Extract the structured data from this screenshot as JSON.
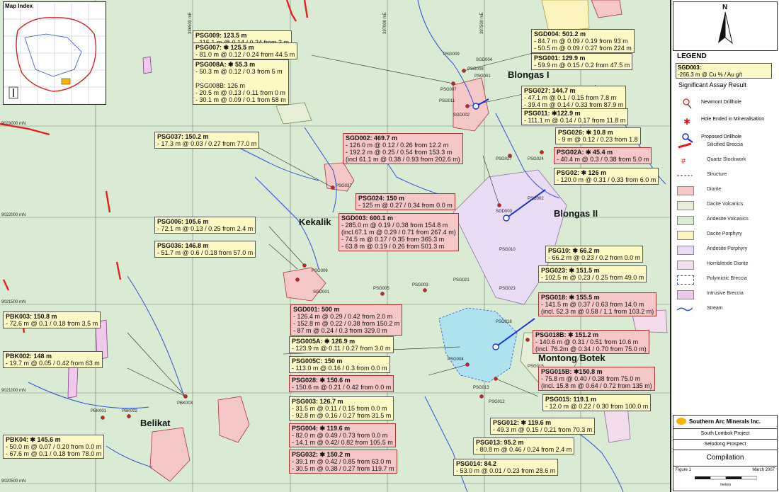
{
  "inset": {
    "title": "Map Index"
  },
  "places": [
    {
      "id": "blongas-1",
      "text": "Blongas I"
    },
    {
      "id": "blongas-2",
      "text": "Blongas II"
    },
    {
      "id": "kekalik",
      "text": "Kekalik"
    },
    {
      "id": "montong-botek",
      "text": "Montong Botek"
    },
    {
      "id": "belikat",
      "text": "Belikat"
    }
  ],
  "coords": {
    "north": [
      "9023000 mN",
      "9022000 mN",
      "9021500 mN",
      "9021000 mN",
      "9020500 mN"
    ],
    "east": [
      "396500 mE",
      "397000 mE",
      "397500 mE"
    ]
  },
  "hole_labels": [
    "PSG009",
    "PSG008",
    "PSG007",
    "PSG006",
    "PSG001",
    "PSG002",
    "PSG037",
    "PSG027",
    "PSG024",
    "PSG010",
    "PSG023",
    "PSG005",
    "PSG003",
    "PSG021",
    "PSG018",
    "PSG011",
    "PSG015",
    "PSG013",
    "PSG004",
    "PSG012",
    "PBK003",
    "PBK001",
    "PBK002",
    "SGD001",
    "SGD002",
    "SGD003",
    "SGD004"
  ],
  "labels": [
    {
      "id": "psg009",
      "style": "yel",
      "lines": [
        "PSG009: 123.5 m",
        "- 115.1 m @ 0.14 / 0.24 from 3 m"
      ]
    },
    {
      "id": "psg007",
      "style": "yel",
      "lines": [
        "PSG007: ✱ 125.5 m",
        "- 81.0 m @ 0.12 / 0.24 from 44.5 m"
      ]
    },
    {
      "id": "psg008a",
      "style": "yel",
      "lines": [
        "PSG008A: ✱ 55.3 m",
        "- 50.3 m @ 0.12 / 0.3 from 5 m",
        "",
        "PSG008B:      126 m",
        "- 20.5 m @ 0.13 / 0.11 from 0 m",
        "- 30.1 m @ 0.09 / 0.1 from 58 m"
      ]
    },
    {
      "id": "sgd004",
      "style": "yel",
      "lines": [
        "SGD004: 501.2 m",
        "- 84.7 m @ 0.09 / 0.19 from 93 m",
        "- 50.5 m @ 0.09 / 0.27 from 224 m"
      ]
    },
    {
      "id": "psg001",
      "style": "yel",
      "lines": [
        "PSG001: 129.9 m",
        "- 59.9 m @ 0.15 / 0.2 from 47.5 m"
      ]
    },
    {
      "id": "psg027",
      "style": "yel",
      "lines": [
        "PSG027: 144.7 m",
        "- 47.1 m @ 0.1 / 0.15 from 7.8 m",
        "- 39.4 m @ 0.14 / 0.33 from 87.9 m"
      ]
    },
    {
      "id": "psg011",
      "style": "yel",
      "lines": [
        "PSG011: ✱122.9 m",
        "- 111.1 m @ 0.14 / 0.17 from 11.8 m"
      ]
    },
    {
      "id": "psg026",
      "style": "yel",
      "lines": [
        "PSG026: ✱ 10.8 m",
        "- 9 m @ 0.12 / 0.23 from 1.8"
      ]
    },
    {
      "id": "psg02a",
      "style": "pnk",
      "lines": [
        "PSG02A: ✱ 45.4 m",
        "- 40.4 m @ 0.3 / 0.38 from 5.0 m"
      ]
    },
    {
      "id": "psg02",
      "style": "yel",
      "lines": [
        "PSG02: ✱ 126 m",
        "- 120.0 m @ 0.31 / 0.33 from 6.0 m"
      ]
    },
    {
      "id": "psg037",
      "style": "yel",
      "lines": [
        "PSG037: 150.2 m",
        "- 17.3 m @ 0.03 / 0.27 from 77.0 m"
      ]
    },
    {
      "id": "sgd002",
      "style": "pnk",
      "lines": [
        "SGD002: 469.7 m",
        "- 126.0 m @ 0.12 / 0.26 from 12.2 m",
        "- 192.2 m @ 0.25 / 0.54 from 153.3 m",
        "(incl 61.1 m @ 0.38 / 0.93 from 202.6 m)"
      ]
    },
    {
      "id": "psg024",
      "style": "pnk",
      "lines": [
        "PSG024: 150 m",
        "- 125 m @ 0.27 / 0.34 from 0.0 m"
      ]
    },
    {
      "id": "psg006",
      "style": "yel",
      "lines": [
        "PSG006: 105.6 m",
        "- 72.1 m @ 0.13 / 0.25 from 2.4 m"
      ]
    },
    {
      "id": "psg036",
      "style": "yel",
      "lines": [
        "PSG036: 146.8 m",
        "- 51.7 m @ 0.6 / 0.18 from 57.0 m"
      ]
    },
    {
      "id": "sgd003",
      "style": "pnk",
      "lines": [
        "SGD003: 600.1 m",
        "- 285.0 m @ 0.19 / 0.38 from 154.8 m",
        "(incl.67.1 m @ 0.29 / 0.71 from 267.4 m)",
        "- 74.5 m @ 0.17 / 0.35 from 365.3 m",
        "- 63.8 m @ 0.19 / 0.26 from 501.3 m"
      ]
    },
    {
      "id": "psg10",
      "style": "yel",
      "lines": [
        "PSG10: ✱ 66.2 m",
        "- 66.2 m @ 0.23 / 0.2 from 0.0 m"
      ]
    },
    {
      "id": "psg023",
      "style": "yel",
      "lines": [
        "PSG023: ✱ 151.5 m",
        "- 102.5 m @ 0.23 / 0.25 from 49.0 m"
      ]
    },
    {
      "id": "psg018",
      "style": "pnk",
      "lines": [
        "PSG018: ✱ 155.5 m",
        "- 141.5 m @ 0.37 / 0.63 from 14.0 m",
        "(incl. 52.3 m @ 0.58 / 1.1 from 103.2 m)"
      ]
    },
    {
      "id": "sgd001",
      "style": "pnk",
      "lines": [
        "SGD001: 500 m",
        "- 126.4 m @ 0.29 / 0.42 from 2.0 m",
        "- 152.8 m @ 0.22 / 0.38 from 150.2 m",
        "- 87 m @ 0.24 / 0.3 from 329.0 m"
      ]
    },
    {
      "id": "pbk003",
      "style": "yel",
      "lines": [
        "PBK003:      150.8 m",
        "- 72.6 m @ 0.1 / 0.18 from 3.5 m"
      ]
    },
    {
      "id": "psg005a",
      "style": "yel",
      "lines": [
        "PSG005A: ✱ 126.9 m",
        "- 123.9 m @ 0.11 / 0.27 from 3.0 m"
      ]
    },
    {
      "id": "psg018b",
      "style": "pnk",
      "lines": [
        "PSG018B: ✱ 151.2 m",
        "- 140.6 m @ 0.31 / 0.51 from 10.6 m",
        "(incl. 76.2m @ 0.34 / 0.70 from 75.0 m)"
      ]
    },
    {
      "id": "pbk002",
      "style": "yel",
      "lines": [
        "PBK002: 148 m",
        "- 19.7 m @ 0.05 / 0.42 from 63 m"
      ]
    },
    {
      "id": "psg005c",
      "style": "yel",
      "lines": [
        "PSG005C:      150 m",
        "- 113.0 m @ 0.16 / 0.3 from 0.0 m"
      ]
    },
    {
      "id": "psg028",
      "style": "pnk",
      "lines": [
        "PSG028: ✱ 150.6 m",
        "- 150.6 m @ 0.21 / 0.42 from 0.0 m"
      ]
    },
    {
      "id": "psg015b",
      "style": "pnk",
      "lines": [
        "PSG015B: ✱150.8 m",
        "- 75.8 m @ 0.40 / 0.38 from 75.0 m",
        "(incl. 15.8 m @ 0.64 / 0.72 from 135 m)"
      ]
    },
    {
      "id": "psg003",
      "style": "yel",
      "lines": [
        "PSG003: 126.7 m",
        "- 31.5 m @ 0.11 / 0.15 from 0.0 m",
        "- 92.8 m @ 0.16 / 0.27 from 31.5 m"
      ]
    },
    {
      "id": "psg015",
      "style": "yel",
      "lines": [
        "PSG015: 119.1 m",
        "- 12.0 m @ 0.22 / 0.30 from 100.0 m"
      ]
    },
    {
      "id": "psg004",
      "style": "pnk",
      "lines": [
        "PSG004: ✱ 119.6 m",
        "- 82.0 m @ 0.49 / 0.73 from 0.0 m",
        "- 14.1 m @ 0.42/ 0.82 from 105.5 m"
      ]
    },
    {
      "id": "psg012",
      "style": "yel",
      "lines": [
        "PSG012: ✱ 119.6 m",
        "- 49.3 m @ 0.15 / 0.21 from 70.3 m"
      ]
    },
    {
      "id": "pbk04",
      "style": "yel",
      "lines": [
        "PBK04: ✱ 145.6 m",
        "- 50.0 m @ 0.07 / 0.20 from 0.0 m",
        "- 67.6 m @ 0.1 / 0.18 from 78.0 m"
      ]
    },
    {
      "id": "psg013",
      "style": "yel",
      "lines": [
        "PSG013: 95.2 m",
        "- 80.8 m @ 0.46 / 0.24 from 2.4 m"
      ]
    },
    {
      "id": "psg032",
      "style": "pnk",
      "lines": [
        "PSG032: ✱ 150.2 m",
        "- 39.1 m @ 0.42 / 0.85 from 63.0 m",
        "- 30.5 m @ 0.38 / 0.27 from 119.7 m"
      ]
    },
    {
      "id": "psg014",
      "style": "yel",
      "lines": [
        "PSG014: 84.2",
        "- 53.0 m @ 0.01 / 0.23 from 28.6 m"
      ]
    }
  ],
  "legend": {
    "north": "N",
    "title": "LEGEND",
    "sample_lines": [
      "SGD003:",
      "-266.3 m @ Cu % / Au g/t"
    ],
    "sample_caption": "Significant Assay Result",
    "symbols": [
      {
        "id": "newmont-drillhole",
        "text": "Newmont Drillhole"
      },
      {
        "id": "hole-ended",
        "text": "Hole Ended in Mineralisation"
      },
      {
        "id": "proposed-drillhole",
        "text": "Proposed Drillhole"
      }
    ],
    "items": [
      {
        "id": "silicified-breccia",
        "text": "Silicified Breccia",
        "color": "#e32020"
      },
      {
        "id": "quartz-stockwork",
        "text": "Quartz Stockwork",
        "color": "#e32020"
      },
      {
        "id": "structure",
        "text": "Structure",
        "color": "#333333"
      },
      {
        "id": "diorite",
        "text": "Diorite",
        "color": "#f6c7c7"
      },
      {
        "id": "dacite-volcanics",
        "text": "Dacite Volcanics",
        "color": "#e6eed7"
      },
      {
        "id": "andesite-volcanics",
        "text": "Andesite Volcanics",
        "color": "#d9ecd3"
      },
      {
        "id": "dacite-porphyry",
        "text": "Dacite Porphyry",
        "color": "#fbf3bd"
      },
      {
        "id": "andesite-porphyry",
        "text": "Andesite Porphyry",
        "color": "#eadcf4"
      },
      {
        "id": "hornblende-diorite",
        "text": "Hornblende Diorite",
        "color": "#f3dcec"
      },
      {
        "id": "polymictic-breccia",
        "text": "Polymictic Breccia",
        "color": "#ffffff"
      },
      {
        "id": "intrusive-breccia",
        "text": "Intrusive Breccia",
        "color": "#f0c8ec"
      },
      {
        "id": "stream",
        "text": "Stream",
        "color": "#2b4fd8"
      }
    ],
    "company": "Southern Arc Minerals Inc.",
    "project": "South Lombok Project",
    "prospect": "Selodong Prospect",
    "sheet": "Compilation",
    "figure": "Figure 1",
    "date": "March 2007",
    "scale_unit": "meters"
  },
  "colors": {
    "andesite": "#d9ecd3",
    "diorite": "#f6c7c7",
    "stream": "#2b4fd8",
    "label_yellow": "#fdf9c4",
    "label_pink": "#f6c7c7"
  }
}
